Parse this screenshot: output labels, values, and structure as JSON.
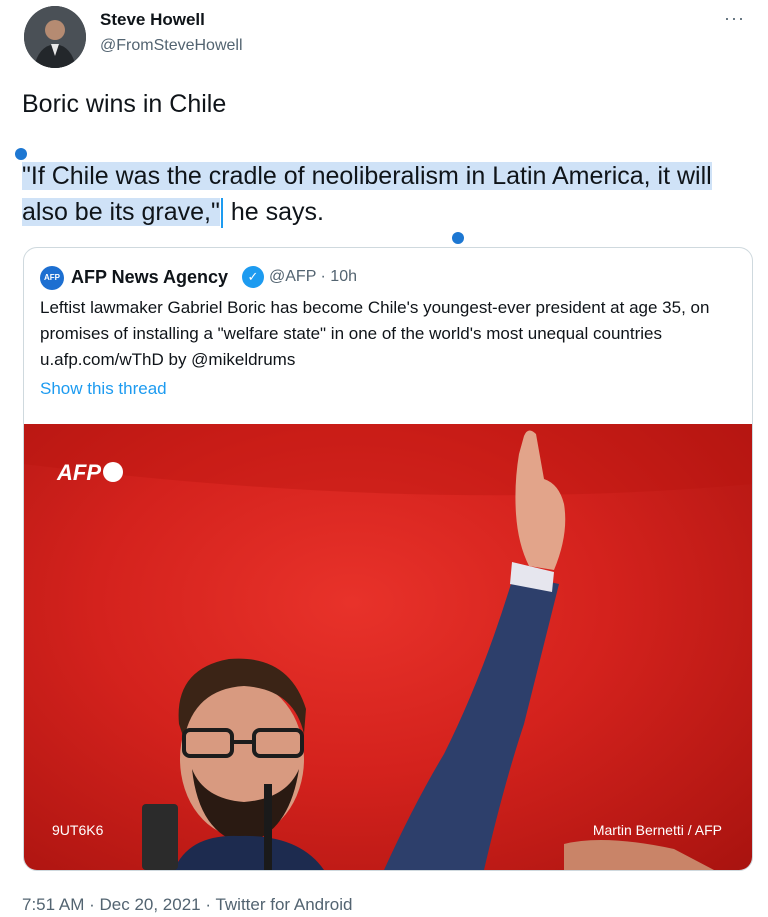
{
  "author": {
    "name": "Steve Howell",
    "handle": "@FromSteveHowell"
  },
  "more_label": "···",
  "tweet": {
    "line1": "Boric wins in Chile",
    "quote_selected": "\"If Chile was the cradle of neoliberalism in Latin America, it will also be its grave,\"",
    "quote_rest": " he says."
  },
  "quoted": {
    "badge": "AFP",
    "name": "AFP News Agency",
    "handle_time": "@AFP · 10h",
    "text": "Leftist lawmaker Gabriel Boric has become Chile's youngest-ever president at age 35, on promises of installing a \"welfare state\" in one of the world's most unequal countries u.afp.com/wThD by @mikeldrums",
    "show_thread": "Show this thread",
    "photo": {
      "logo": "AFP",
      "code": "9UT6K6",
      "credit": "Martin Bernetti / AFP"
    }
  },
  "meta": {
    "time": "7:51 AM",
    "date": "Dec 20, 2021",
    "source": "Twitter for Android"
  },
  "colors": {
    "accent": "#1d9bf0",
    "selection": "#cfe2f7",
    "photo_bg": "#d4221d"
  }
}
